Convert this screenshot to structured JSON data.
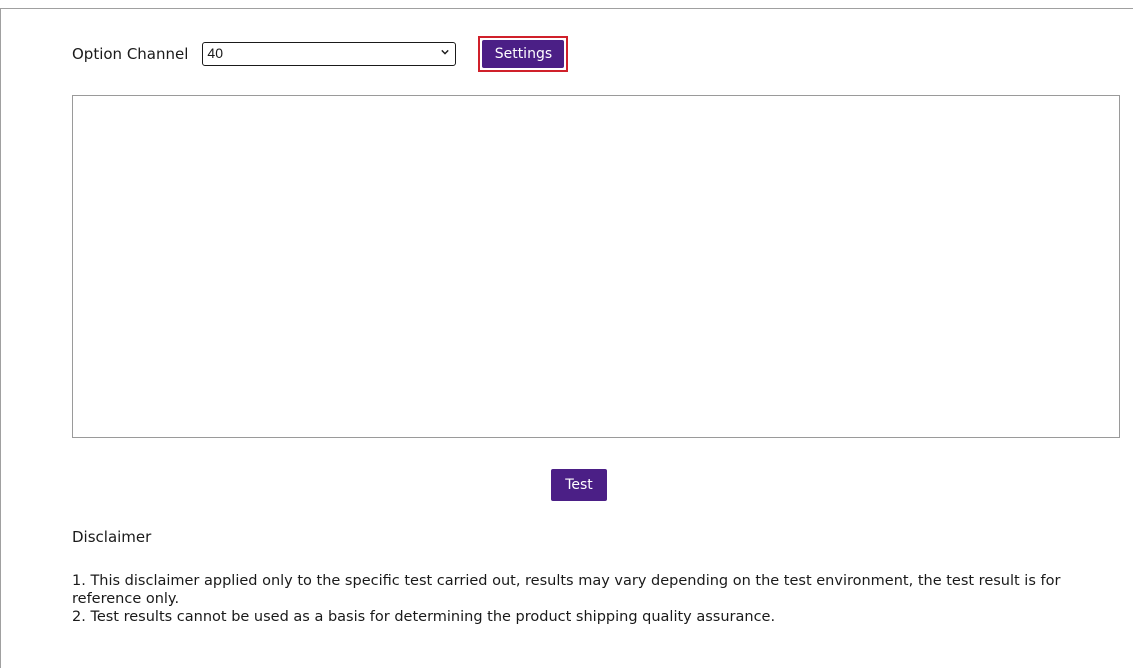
{
  "option_channel": {
    "label": "Option Channel",
    "selected_value": "40"
  },
  "settings_button": {
    "label": "Settings"
  },
  "test_button": {
    "label": "Test"
  },
  "disclaimer": {
    "title": "Disclaimer",
    "items": [
      "1. This disclaimer applied only to the specific test carried out, results may vary depending on the test environment, the test result is for reference only.",
      "2. Test results cannot be used as a basis for determining the product shipping quality assurance."
    ]
  },
  "colors": {
    "button_bg": "#4b1f86",
    "highlight_border": "#d0202a"
  },
  "icons": {
    "select_arrow": "chevron-down-icon"
  }
}
